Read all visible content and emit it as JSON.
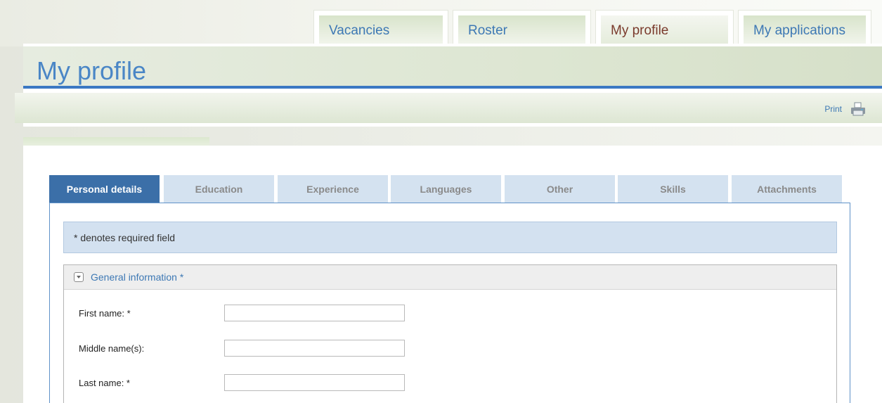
{
  "nav": {
    "tabs": [
      {
        "label": "Vacancies"
      },
      {
        "label": "Roster"
      },
      {
        "label": "My profile"
      },
      {
        "label": "My applications"
      }
    ]
  },
  "header": {
    "title": "My profile",
    "print_label": "Print"
  },
  "sub_tabs": [
    {
      "label": "Personal details"
    },
    {
      "label": "Education"
    },
    {
      "label": "Experience"
    },
    {
      "label": "Languages"
    },
    {
      "label": "Other"
    },
    {
      "label": "Skills"
    },
    {
      "label": "Attachments"
    }
  ],
  "notice": "* denotes required field",
  "section": {
    "title": "General information *",
    "fields": [
      {
        "label": "First name: *",
        "value": ""
      },
      {
        "label": "Middle name(s):",
        "value": ""
      },
      {
        "label": "Last name: *",
        "value": ""
      }
    ]
  },
  "colors": {
    "accent": "#3b78c3",
    "link": "#3d78b4",
    "active_tab": "#3b6fa8"
  }
}
